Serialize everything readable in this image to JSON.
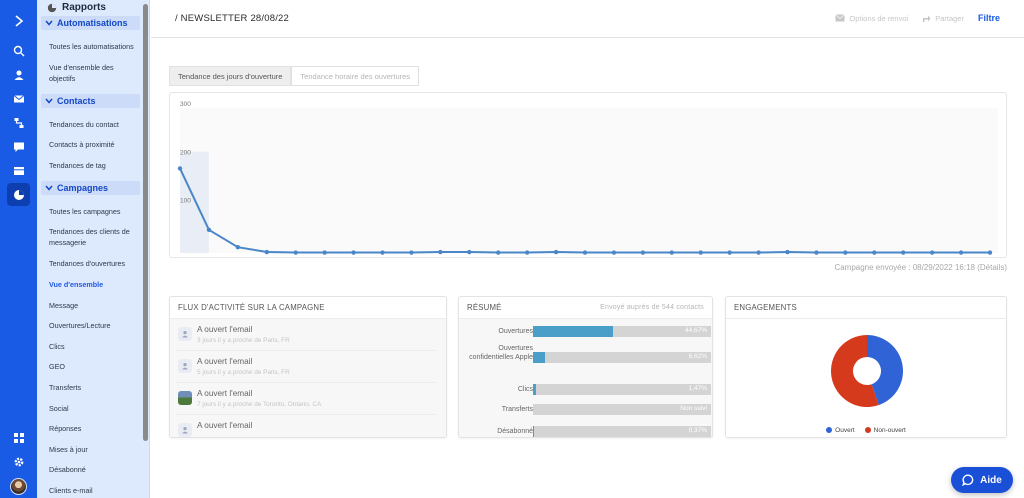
{
  "subnav": {
    "title": "Rapports",
    "sections": [
      {
        "label": "Automatisations",
        "items": [
          "Toutes les automatisations",
          "Vue d'ensemble des objectifs"
        ]
      },
      {
        "label": "Contacts",
        "items": [
          "Tendances du contact",
          "Contacts à proximité",
          "Tendances de tag"
        ]
      },
      {
        "label": "Campagnes",
        "items": [
          "Toutes les campagnes",
          "Tendances des clients de messagerie",
          "Tendances d'ouvertures",
          "Vue d'ensemble",
          "Message",
          "Ouvertures/Lecture",
          "Clics",
          "GEO",
          "Transferts",
          "Social",
          "Réponses",
          "Mises à jour",
          "Désabonné",
          "Clients e-mail"
        ]
      }
    ]
  },
  "header": {
    "breadcrumb": "/  NEWSLETTER 28/08/22",
    "resend_label": "Options de renvoi",
    "share_label": "Partager",
    "filter_label": "Filtre"
  },
  "tabs": [
    "Tendance des jours d'ouverture",
    "Tendance horaire des ouvertures"
  ],
  "chart_data": {
    "type": "line",
    "title": "",
    "xlabel": "",
    "ylabel": "",
    "y_ticks": [
      "300",
      "200",
      "100"
    ],
    "ylim": [
      0,
      300
    ],
    "grid": false,
    "legend": "none",
    "color": "#4a86c8",
    "x": [
      0,
      1,
      2,
      3,
      4,
      5,
      6,
      7,
      8,
      9,
      10,
      11,
      12,
      13,
      14,
      15,
      16,
      17,
      18,
      19,
      20,
      21,
      22,
      23,
      24,
      25,
      26,
      27,
      28
    ],
    "values": [
      175,
      48,
      12,
      2,
      1,
      1,
      1,
      1,
      1,
      2,
      2,
      1,
      1,
      2,
      1,
      1,
      1,
      1,
      1,
      1,
      1,
      2,
      1,
      1,
      1,
      1,
      1,
      1,
      1
    ]
  },
  "sent_info": "Campagne envoyée : 08/29/2022 16:18 (Détails)",
  "feed": {
    "title": "FLUX D'ACTIVITÉ SUR LA CAMPAGNE",
    "items": [
      {
        "title": "A ouvert l'email",
        "meta": "3 jours il y a proche de Paris, FR"
      },
      {
        "title": "A ouvert l'email",
        "meta": "5 jours il y a proche de Paris, FR"
      },
      {
        "title": "A ouvert l'email",
        "meta": "7 jours il y a proche de Toronto, Ontario, CA"
      },
      {
        "title": "A ouvert l'email",
        "meta": ""
      }
    ]
  },
  "summary": {
    "title": "RÉSUMÉ",
    "note": "Envoyé auprès de 544 contacts",
    "rows": [
      {
        "label": "Ouvertures",
        "value": "44,67%",
        "fraction": 0.4467
      },
      {
        "label": "Ouvertures confidentielles Apple",
        "value": "6,62%",
        "fraction": 0.0662
      },
      {
        "label": "Clics",
        "value": "1,47%",
        "fraction": 0.0147
      },
      {
        "label": "Transferts",
        "value": "Non suivi",
        "fraction": 0
      },
      {
        "label": "Désabonné",
        "value": "0,37%",
        "fraction": 0.0037
      }
    ]
  },
  "engagement": {
    "title": "ENGAGEMENTS",
    "legend_open": "Ouvert",
    "legend_closed": "Non-ouvert",
    "open_fraction": 0.4467,
    "color_open": "#2f63d6",
    "color_closed": "#d63a1c"
  },
  "help_label": "Aide",
  "colors": {
    "primary": "#1a5be6",
    "subnav_bg": "#dde9fc"
  }
}
